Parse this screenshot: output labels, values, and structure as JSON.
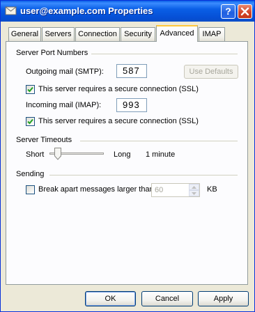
{
  "window": {
    "title": "user@example.com Properties",
    "help_label": "?",
    "close_label": "✕"
  },
  "tabs": [
    {
      "label": "General"
    },
    {
      "label": "Servers"
    },
    {
      "label": "Connection"
    },
    {
      "label": "Security"
    },
    {
      "label": "Advanced",
      "active": true
    },
    {
      "label": "IMAP"
    }
  ],
  "server_ports": {
    "group_label": "Server Port Numbers",
    "outgoing_label": "Outgoing mail (SMTP):",
    "outgoing_value": "587",
    "use_defaults_label": "Use Defaults",
    "outgoing_ssl_label": "This server requires a secure connection (SSL)",
    "outgoing_ssl_checked": true,
    "incoming_label": "Incoming mail (IMAP):",
    "incoming_value": "993",
    "incoming_ssl_label": "This server requires a secure connection (SSL)",
    "incoming_ssl_checked": true
  },
  "timeouts": {
    "group_label": "Server Timeouts",
    "short_label": "Short",
    "long_label": "Long",
    "value_text": "1 minute",
    "slider_level": 0.1
  },
  "sending": {
    "group_label": "Sending",
    "break_apart_label": "Break apart messages larger than",
    "break_apart_checked": false,
    "size_value": "60",
    "size_unit": "KB"
  },
  "footer": {
    "ok_label": "OK",
    "cancel_label": "Cancel",
    "apply_label": "Apply"
  },
  "colors": {
    "titlebar": "#0a5fe6",
    "dialog_bg": "#ece9d8",
    "active_tab_accent": "#ffc83c",
    "checkmark": "#21a121"
  }
}
